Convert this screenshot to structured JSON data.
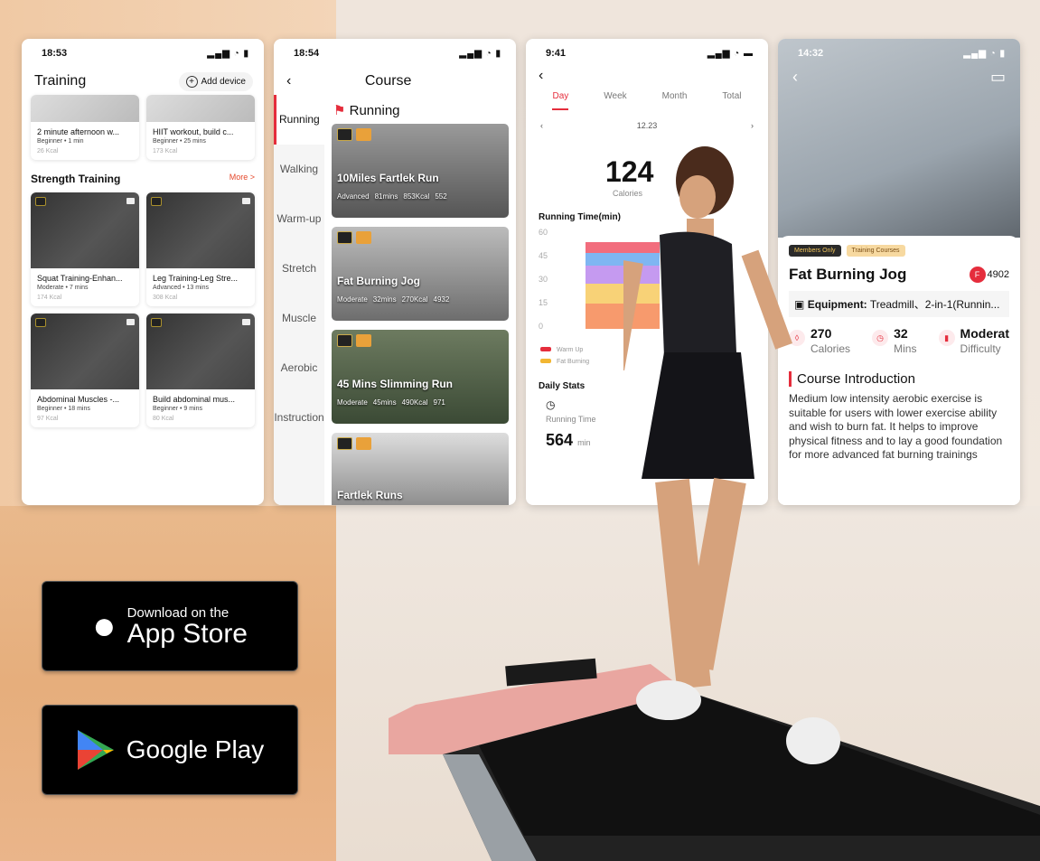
{
  "phone1": {
    "time": "18:53",
    "battery": "72",
    "title": "Training",
    "add_device": "Add device",
    "top_cards": [
      {
        "title": "2 minute afternoon w...",
        "meta": "Beginner • 1 min",
        "kcal": "26 Kcal"
      },
      {
        "title": "HIIT workout, build c...",
        "meta": "Beginner • 25 mins",
        "kcal": "173 Kcal"
      }
    ],
    "section": "Strength Training",
    "more": "More >",
    "cards": [
      {
        "title": "Squat Training-Enhan...",
        "meta": "Moderate • 7 mins",
        "kcal": "174 Kcal"
      },
      {
        "title": "Leg Training-Leg Stre...",
        "meta": "Advanced • 13 mins",
        "kcal": "308 Kcal"
      },
      {
        "title": "Abdominal Muscles -...",
        "meta": "Beginner • 18 mins",
        "kcal": "97 Kcal"
      },
      {
        "title": "Build abdominal mus...",
        "meta": "Beginner • 9 mins",
        "kcal": "80 Kcal"
      }
    ]
  },
  "phone2": {
    "time": "18:54",
    "battery": "71",
    "title": "Course",
    "heading": "Running",
    "categories": [
      "Running",
      "Walking",
      "Warm-up",
      "Stretch",
      "Muscle",
      "Aerobic",
      "Instruction"
    ],
    "courses": [
      {
        "name": "10Miles Fartlek Run",
        "level": "Advanced",
        "mins": "81mins",
        "kcal": "853Kcal",
        "users": "552"
      },
      {
        "name": "Fat Burning Jog",
        "level": "Moderate",
        "mins": "32mins",
        "kcal": "270Kcal",
        "users": "4932"
      },
      {
        "name": "45 Mins Slimming Run",
        "level": "Moderate",
        "mins": "45mins",
        "kcal": "490Kcal",
        "users": "971"
      },
      {
        "name": "Fartlek Runs",
        "level": "",
        "mins": "",
        "kcal": "",
        "users": ""
      }
    ]
  },
  "phone3": {
    "time": "9:41",
    "tabs": [
      "Day",
      "Week",
      "Month",
      "Total"
    ],
    "date": "12.23",
    "calories_value": "124",
    "calories_label": "Calories",
    "chart_title": "Running Time(min)",
    "y_ticks": [
      "60",
      "45",
      "30",
      "15",
      "0"
    ],
    "legend": [
      "Warm Up",
      "Fat Burning"
    ],
    "daily": "Daily Stats",
    "running_time_label": "Running Time",
    "running_time": "564",
    "unit": "min",
    "colors": {
      "warm": "#e52d3c",
      "fat": "#f2b632",
      "blue": "#4ea3f5",
      "orange": "#f06c2c"
    }
  },
  "phone4": {
    "time": "14:32",
    "battery": "88",
    "pills": [
      "Members Only",
      "Training Courses"
    ],
    "title": "Fat Burning Jog",
    "count": "4902",
    "avatar": "F",
    "equipment_label": "Equipment:",
    "equipment": "Treadmill、2-in-1(Runnin...",
    "stats": [
      {
        "value": "270",
        "label": "Calories"
      },
      {
        "value": "32",
        "label": "Mins"
      },
      {
        "value": "Moderat",
        "label": "Difficulty"
      }
    ],
    "intro_title": "Course Introduction",
    "intro": "Medium low intensity aerobic exercise is suitable for users with lower exercise ability and wish to burn fat. It helps to improve physical fitness and to lay a good foundation for more advanced fat burning trainings"
  },
  "stores": {
    "apple_small": "Download on the",
    "apple_big": "App Store",
    "google": "Google Play"
  }
}
